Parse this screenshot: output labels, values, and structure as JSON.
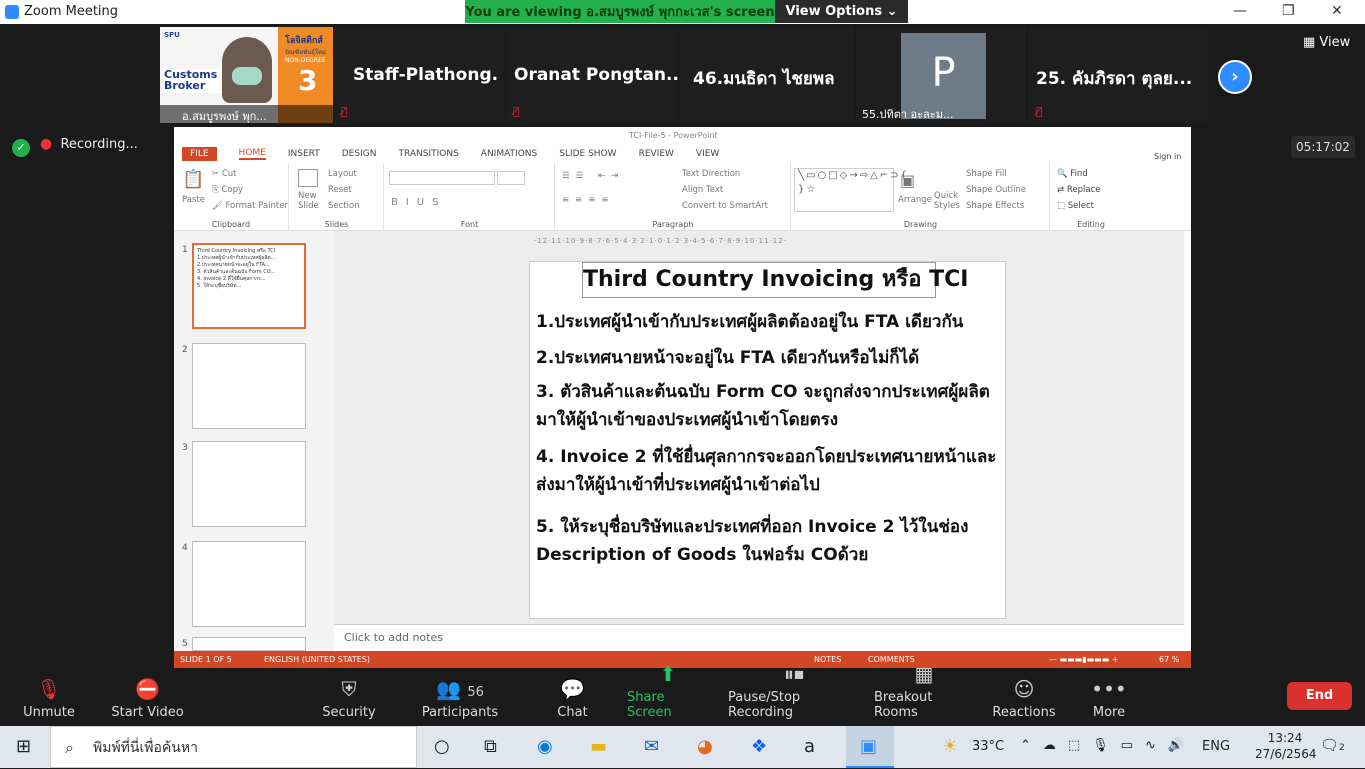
{
  "window": {
    "title": "Zoom Meeting"
  },
  "banner": {
    "viewing": "You are viewing อ.สมบูรพงษ์  พุกกะเวส's screen",
    "view_options": "View Options ⌄"
  },
  "participants": [
    {
      "name": "อ.สมบูรพงษ์  พุก..."
    },
    {
      "name": "Staff-Plathong."
    },
    {
      "name": "Oranat  Pongtan..."
    },
    {
      "name": "46.มนธิดา  ไชยพล"
    },
    {
      "name": "55.ปทิตา อะละม...",
      "avatar_letter": "P"
    },
    {
      "name": "25. คัมภิรดา  ตุลย..."
    }
  ],
  "speaker_slide": {
    "brand": "SPU",
    "title1": "โลจิสติกส์",
    "title2": "บัณฑิตพันธุ์ใหม่",
    "title3": "NON-DEGREE",
    "course": "Customs",
    "course2": "Broker",
    "num": "3"
  },
  "view_label": "View",
  "recording": {
    "label": "Recording...",
    "timer": "05:17:02"
  },
  "ppt": {
    "window_title": "TCI-File-5 - PowerPoint",
    "sign_in": "Sign in",
    "tabs": [
      "FILE",
      "HOME",
      "INSERT",
      "DESIGN",
      "TRANSITIONS",
      "ANIMATIONS",
      "SLIDE SHOW",
      "REVIEW",
      "VIEW"
    ],
    "ribbon": {
      "paste": "Paste",
      "cut": "Cut",
      "copy": "Copy",
      "format_painter": "Format Painter",
      "clipboard": "Clipboard",
      "new_slide": "New\nSlide",
      "layout": "Layout",
      "reset": "Reset",
      "section": "Section",
      "slides": "Slides",
      "font": "Font",
      "paragraph": "Paragraph",
      "text_direction": "Text Direction",
      "align_text": "Align Text",
      "convert_smartart": "Convert to SmartArt",
      "arrange": "Arrange",
      "quick_styles": "Quick\nStyles",
      "shape_fill": "Shape Fill",
      "shape_outline": "Shape Outline",
      "shape_effects": "Shape Effects",
      "drawing": "Drawing",
      "find": "Find",
      "replace": "Replace",
      "select": "Select",
      "editing": "Editing"
    },
    "thumb_numbers": [
      "1",
      "2",
      "3",
      "4",
      "5"
    ],
    "slide": {
      "title": "Third Country Invoicing หรือ TCI",
      "points": [
        "1.ประเทศผู้นำเข้ากับประเทศผู้ผลิตต้องอยู่ใน FTA เดียวกัน",
        "2.ประเทศนายหน้าจะอยู่ใน FTA เดียวกันหรือไม่ก็ได้",
        "3. ตัวสินค้าและต้นฉบับ Form CO จะถูกส่งจากประเทศผู้ผลิตมาให้ผู้นำเข้าของประเทศผู้นำเข้าโดยตรง",
        "4. Invoice 2 ที่ใช้ยื่นศุลกากรจะออกโดยประเทศนายหน้าและส่งมาให้ผู้นำเข้าที่ประเทศผู้นำเข้าต่อไป",
        "5. ให้ระบุชื่อบริษัทและประเทศที่ออก Invoice 2 ไว้ในช่อง Description of Goods ในฟอร์ม COด้วย"
      ]
    },
    "notes_placeholder": "Click to add notes",
    "status": {
      "slide": "SLIDE 1 OF 5",
      "lang": "ENGLISH (UNITED STATES)",
      "notes": "NOTES",
      "comments": "COMMENTS",
      "zoom": "67 %"
    }
  },
  "toolbar": {
    "unmute": "Unmute",
    "start_video": "Start Video",
    "security": "Security",
    "participants": "Participants",
    "participant_count": "56",
    "chat": "Chat",
    "share": "Share Screen",
    "pause_rec": "Pause/Stop Recording",
    "breakout": "Breakout Rooms",
    "reactions": "Reactions",
    "more": "More",
    "end": "End"
  },
  "taskbar": {
    "search": "พิมพ์ที่นี่เพื่อค้นหา",
    "temp": "33°C",
    "lang": "ENG",
    "time": "13:24",
    "date": "27/6/2564",
    "notif": "2"
  }
}
